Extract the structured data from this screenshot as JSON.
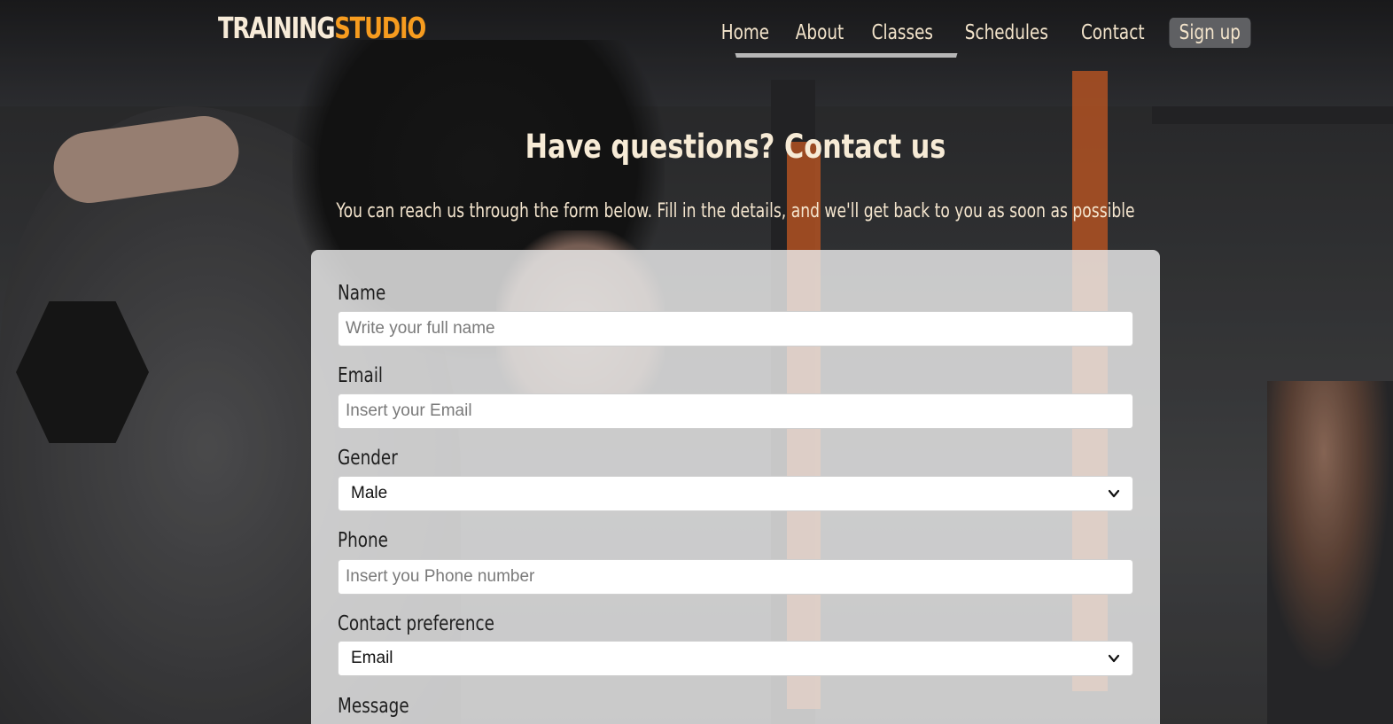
{
  "brand": {
    "part1": "TRAINING",
    "part2": "STUDIO",
    "accent_color": "#f79c1f"
  },
  "nav": {
    "items": [
      {
        "label": "Home"
      },
      {
        "label": "About"
      },
      {
        "label": "Classes"
      },
      {
        "label": "Schedules"
      },
      {
        "label": "Contact"
      }
    ],
    "signup_label": "Sign up"
  },
  "hero": {
    "title": "Have questions? Contact us",
    "subtitle": "You can reach us through the form below. Fill in the details, and we'll get back to you as soon as possible"
  },
  "form": {
    "name": {
      "label": "Name",
      "placeholder": "Write your full name",
      "value": ""
    },
    "email": {
      "label": "Email",
      "placeholder": "Insert your Email",
      "value": ""
    },
    "gender": {
      "label": "Gender",
      "selected": "Male"
    },
    "phone": {
      "label": "Phone",
      "placeholder": "Insert you Phone number",
      "value": ""
    },
    "contact_preference": {
      "label": "Contact preference",
      "selected": "Email"
    },
    "message": {
      "label": "Message"
    }
  }
}
